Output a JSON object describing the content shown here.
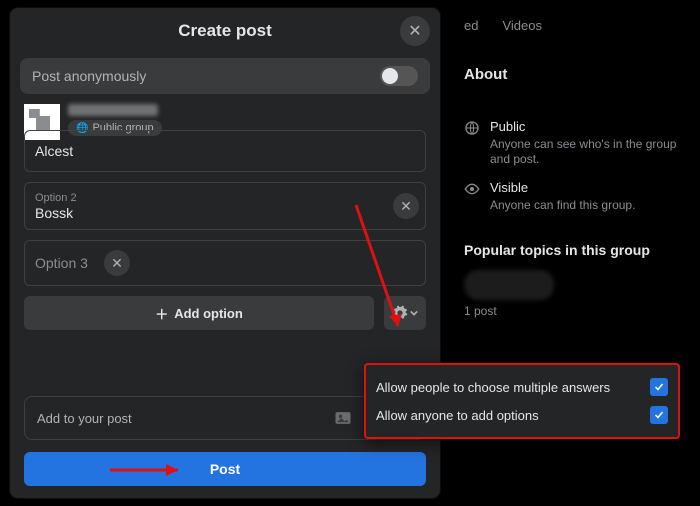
{
  "modal": {
    "title": "Create post",
    "anon_label": "Post anonymously",
    "group_badge": "Public group",
    "options": [
      {
        "label": "",
        "value": "Alcest"
      },
      {
        "label": "Option 2",
        "value": "Bossk"
      },
      {
        "label": "",
        "value": "",
        "placeholder": "Option 3"
      }
    ],
    "add_option": "Add option",
    "attach_label": "Add to your post",
    "post_label": "Post"
  },
  "popup": {
    "opt_multi": "Allow people to choose multiple answers",
    "opt_addopts": "Allow anyone to add options",
    "multi_checked": true,
    "addopts_checked": true
  },
  "bg": {
    "tab1": "ed",
    "tab2": "Videos",
    "about": "About",
    "public_t": "Public",
    "public_d": "Anyone can see who's in the group and post.",
    "visible_t": "Visible",
    "visible_d": "Anyone can find this group.",
    "popular": "Popular topics in this group",
    "post_count": "1 post"
  }
}
